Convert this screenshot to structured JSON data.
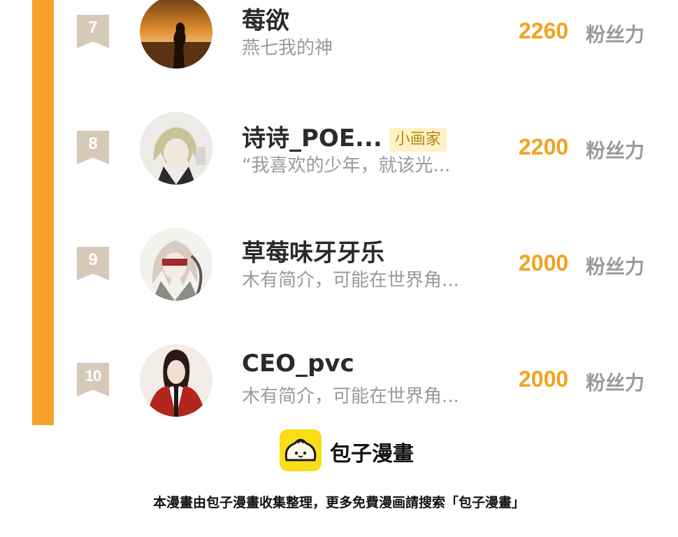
{
  "ranking": {
    "score_unit": "粉丝力",
    "entries": [
      {
        "rank": "7",
        "name": "莓欲",
        "tag": "",
        "bio": "燕七我的神",
        "score": "2260",
        "avatar": "sunset-silhouette-avatar"
      },
      {
        "rank": "8",
        "name": "诗诗_POE...",
        "tag": "小画家",
        "bio": "“我喜欢的少年，就该光...",
        "score": "2200",
        "avatar": "anime-blond-character-avatar"
      },
      {
        "rank": "9",
        "name": "草莓味牙牙乐",
        "tag": "",
        "bio": "木有简介，可能在世界角...",
        "score": "2000",
        "avatar": "anime-blindfold-character-avatar"
      },
      {
        "rank": "10",
        "name": "CEO_pvc",
        "tag": "",
        "bio": "木有简介，可能在世界角...",
        "score": "2000",
        "avatar": "anime-red-robe-character-avatar"
      }
    ]
  },
  "brand": {
    "logo_icon": "baozi-bun-icon",
    "name": "包子漫畫"
  },
  "footer": {
    "text": "本漫畫由包子漫畫收集整理，更多免費漫画請搜索「包子漫畫」"
  },
  "colors": {
    "accent_bar": "#f7a128",
    "score": "#f2a21f",
    "rank_badge": "#d6c9b8",
    "tag_bg": "#fdf3c4",
    "logo_bg": "#f9dd17"
  }
}
